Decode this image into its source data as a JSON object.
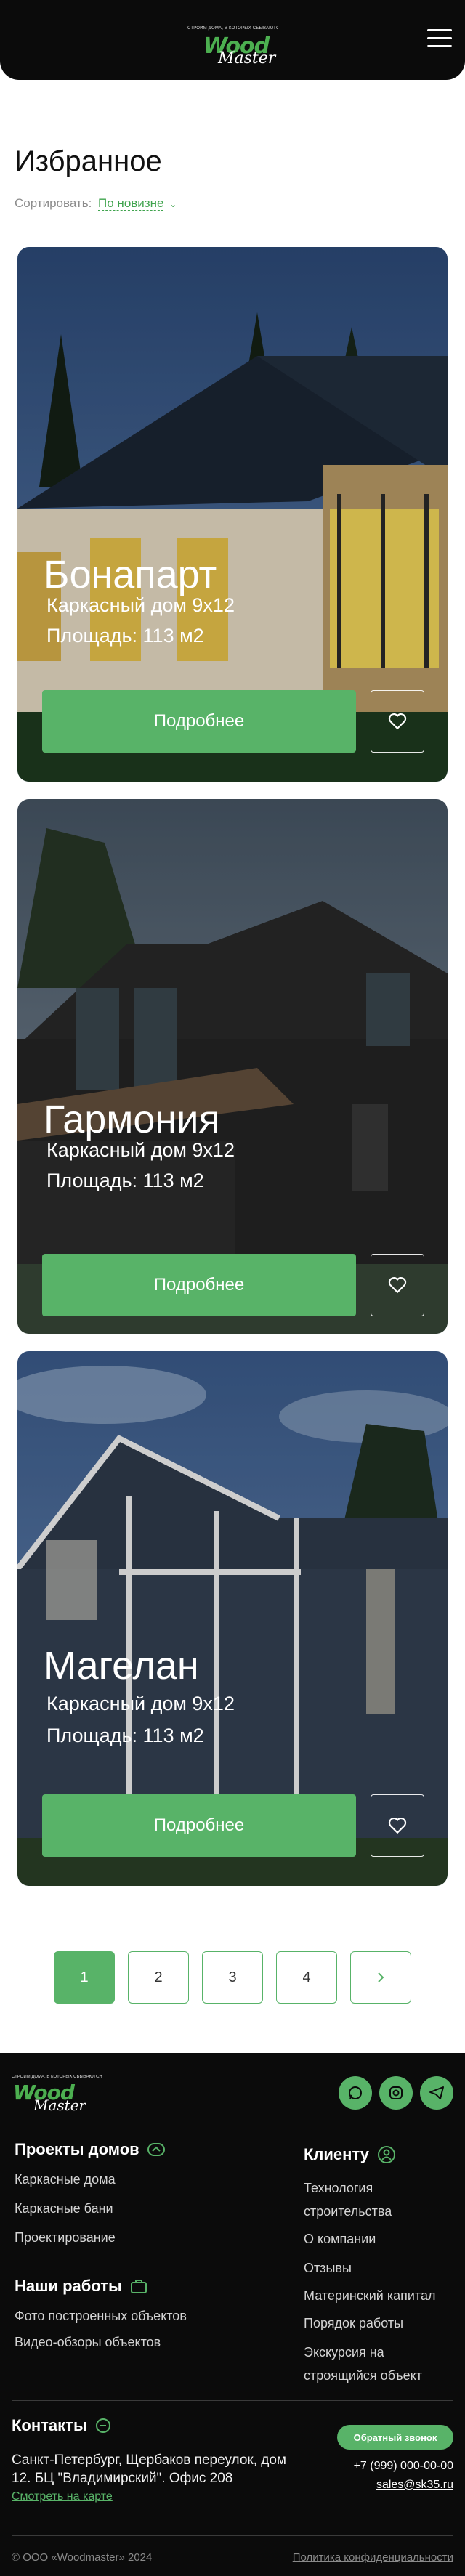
{
  "header": {
    "logo_tagline": "СТРОИМ ДОМА, В КОТОРЫХ СБЫВАЮТСЯ МЕЧТЫ",
    "logo_wood": "Wood",
    "logo_master": "Master",
    "menu_icon": "burger-menu-icon"
  },
  "page": {
    "title": "Избранное",
    "sort_label": "Сортировать:",
    "sort_value": "По новизне"
  },
  "cards": [
    {
      "name": "Бонапарт",
      "type": "Каркасный дом 9х12",
      "area": "Площадь: 113 м2",
      "button": "Подробнее",
      "fav_icon": "heart-icon"
    },
    {
      "name": "Гармония",
      "type": "Каркасный дом 9х12",
      "area": "Площадь: 113 м2",
      "button": "Подробнее",
      "fav_icon": "heart-icon"
    },
    {
      "name": "Магелан",
      "type": "Каркасный дом 9х12",
      "area": "Площадь: 113 м2",
      "button": "Подробнее",
      "fav_icon": "heart-icon"
    }
  ],
  "pagination": {
    "pages": [
      "1",
      "2",
      "3",
      "4"
    ],
    "active": "1",
    "next_icon": "chevron-right-icon"
  },
  "footer": {
    "logo_tagline": "СТРОИМ ДОМА, В КОТОРЫХ СБЫВАЮТСЯ МЕЧТЫ",
    "logo_wood": "Wood",
    "logo_master": "Master",
    "social": [
      "whatsapp-icon",
      "instagram-icon",
      "telegram-icon"
    ],
    "projects": {
      "title": "Проекты домов",
      "items": [
        "Каркасные дома",
        "Каркасные бани",
        "Проектирование"
      ]
    },
    "works": {
      "title": "Наши работы",
      "items": [
        "Фото построенных объектов",
        "Видео-обзоры объектов"
      ]
    },
    "client": {
      "title": "Клиенту",
      "items": [
        "Технология строительства",
        "О компании",
        "Отзывы",
        "Материнский капитал",
        "Порядок работы",
        "Экскурсия на строящийся объект"
      ]
    },
    "contacts": {
      "title": "Контакты",
      "address": "Санкт-Петербург, Щербаков переулок, дом 12. БЦ \"Владимирский\". Офис 208",
      "map_link": "Смотреть на карте",
      "callback": "Обратный звонок",
      "phone": "+7 (999) 000-00-00",
      "email": "sales@sk35.ru"
    },
    "copyright": "© ООО «Woodmaster» 2024",
    "privacy": "Политика конфиденциальности"
  },
  "colors": {
    "accent": "#58b368",
    "header_bg": "#0b0b0b"
  }
}
